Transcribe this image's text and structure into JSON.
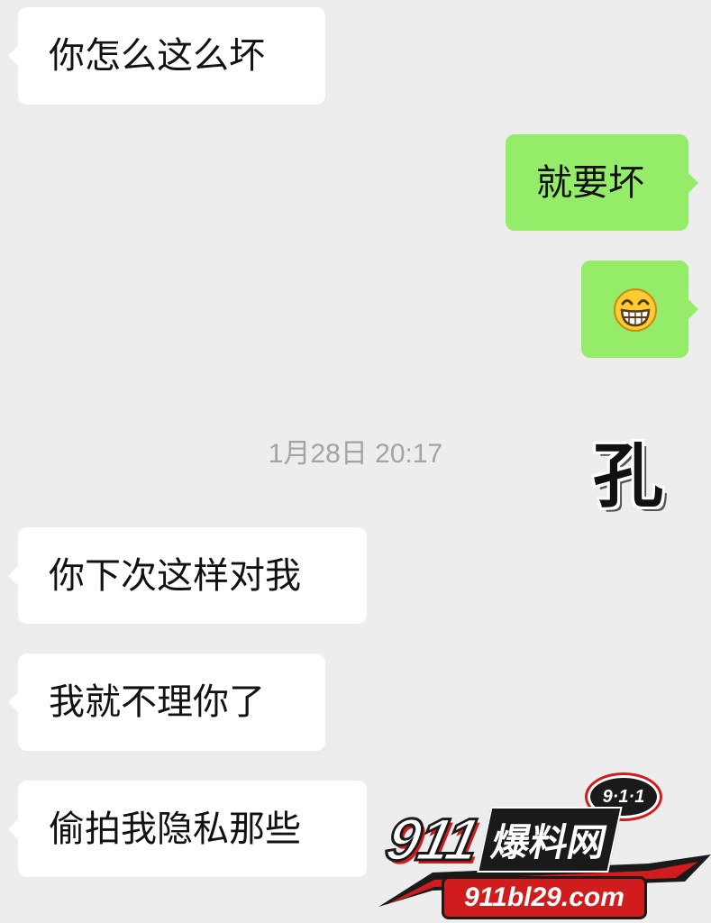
{
  "chat": {
    "messages": [
      {
        "side": "in",
        "text": "你怎么这么坏"
      },
      {
        "side": "out",
        "text": "就要坏"
      },
      {
        "side": "out",
        "emoji": "grinning-face-icon"
      },
      {
        "side": "in",
        "text": "你下次这样对我"
      },
      {
        "side": "in",
        "text": "我就不理你了"
      },
      {
        "side": "in",
        "text": "偷拍我隐私那些"
      }
    ],
    "timestamp": "1月28日 20:17"
  },
  "sticker": {
    "text": "孔"
  },
  "watermark": {
    "badge": "9·1·1",
    "number": "911",
    "name": "爆料网",
    "url": "911bl29.com"
  },
  "colors": {
    "background": "#ededed",
    "incoming_bubble": "#ffffff",
    "outgoing_bubble": "#95ec69",
    "timestamp_text": "#a3a3a3",
    "watermark_red": "#d01c1c"
  }
}
